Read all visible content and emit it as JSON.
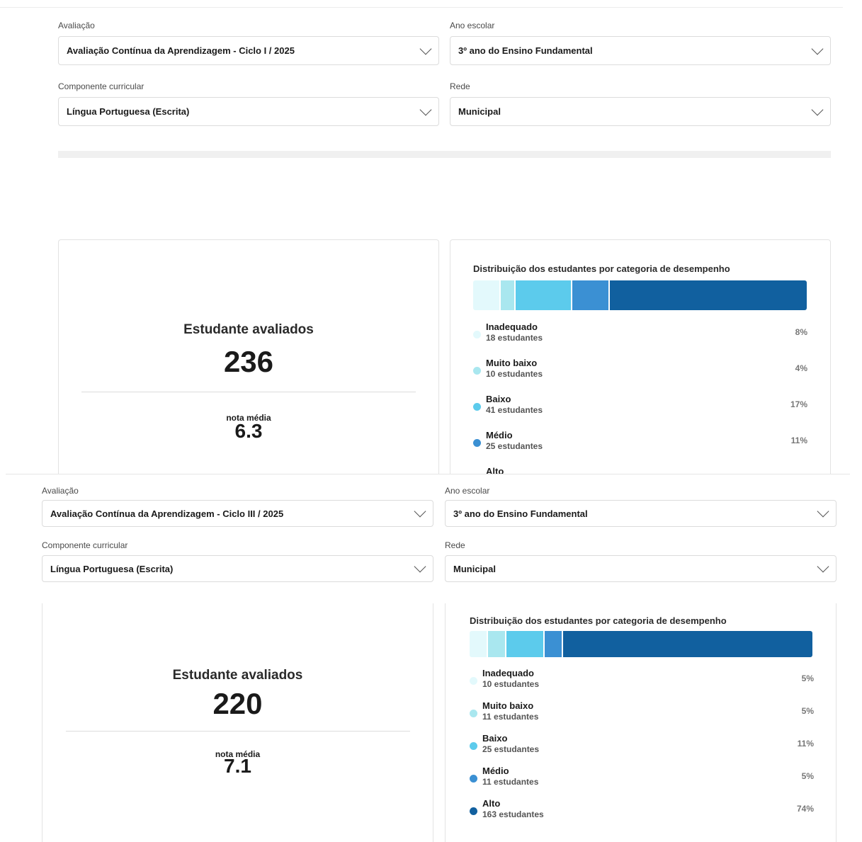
{
  "labels": {
    "avaliacao": "Avaliação",
    "ano_escolar": "Ano escolar",
    "componente": "Componente curricular",
    "rede": "Rede",
    "estudantes": "Estudante avaliados",
    "nota_media": "nota média",
    "distribuicao": "Distribuição dos estudantes por categoria de desempenho"
  },
  "panel1": {
    "filters": {
      "avaliacao": "Avaliação Contínua da Aprendizagem - Ciclo I / 2025",
      "ano_escolar": "3º ano do Ensino Fundamental",
      "componente": "Língua Portuguesa (Escrita)",
      "rede": "Municipal"
    },
    "stats": {
      "count": "236",
      "average": "6.3"
    },
    "categories": [
      {
        "name": "Inadequado",
        "students": "18 estudantes",
        "pct": "8%",
        "share": 8,
        "color": "#e3f9fc"
      },
      {
        "name": "Muito baixo",
        "students": "10 estudantes",
        "pct": "4%",
        "share": 4,
        "color": "#a9e7ef"
      },
      {
        "name": "Baixo",
        "students": "41 estudantes",
        "pct": "17%",
        "share": 17,
        "color": "#5ccbec"
      },
      {
        "name": "Médio",
        "students": "25 estudantes",
        "pct": "11%",
        "share": 11,
        "color": "#3b90d3"
      },
      {
        "name": "Alto",
        "students": "",
        "pct": "",
        "share": 60,
        "color": "#11609f"
      }
    ]
  },
  "panel2": {
    "filters": {
      "avaliacao": "Avaliação Contínua da Aprendizagem - Ciclo III / 2025",
      "ano_escolar": "3º ano do Ensino Fundamental",
      "componente": "Língua Portuguesa (Escrita)",
      "rede": "Municipal"
    },
    "stats": {
      "count": "220",
      "average": "7.1"
    },
    "categories": [
      {
        "name": "Inadequado",
        "students": "10 estudantes",
        "pct": "5%",
        "share": 5,
        "color": "#e3f9fc"
      },
      {
        "name": "Muito baixo",
        "students": "11 estudantes",
        "pct": "5%",
        "share": 5,
        "color": "#a9e7ef"
      },
      {
        "name": "Baixo",
        "students": "25 estudantes",
        "pct": "11%",
        "share": 11,
        "color": "#5ccbec"
      },
      {
        "name": "Médio",
        "students": "11 estudantes",
        "pct": "5%",
        "share": 5,
        "color": "#3b90d3"
      },
      {
        "name": "Alto",
        "students": "163 estudantes",
        "pct": "74%",
        "share": 74,
        "color": "#11609f"
      }
    ]
  }
}
